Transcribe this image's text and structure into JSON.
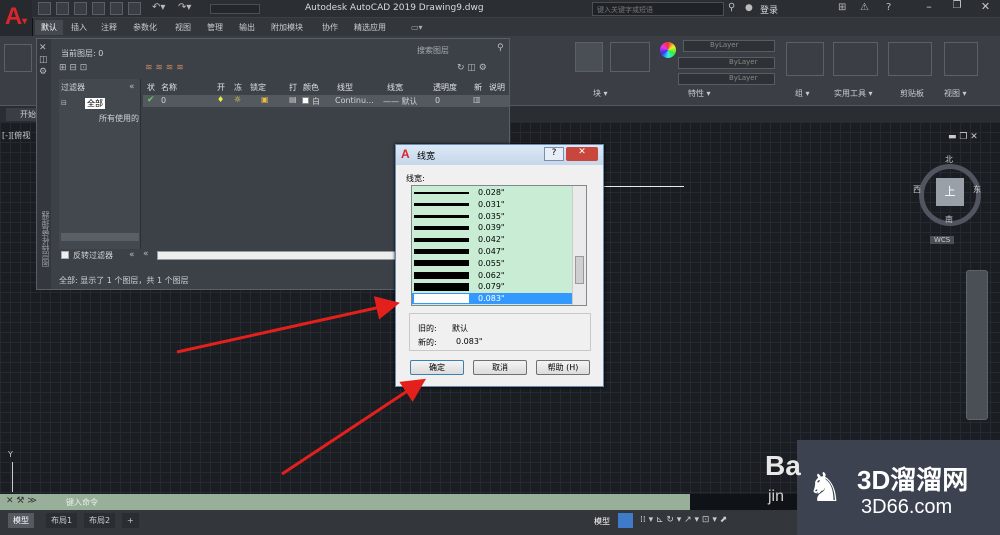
{
  "app": {
    "title": "Autodesk AutoCAD 2019    Drawing9.dwg",
    "search_placeholder": "键入关键字或短语",
    "login_label": "登录",
    "help": "?"
  },
  "ribbon_tabs": [
    "默认",
    "插入",
    "注释",
    "参数化",
    "视图",
    "管理",
    "输出",
    "附加模块",
    "协作",
    "精选应用"
  ],
  "ribbon_groups": [
    "块",
    "特性",
    "组",
    "实用工具",
    "剪贴板",
    "视图"
  ],
  "ribbon_props": [
    "ByLayer",
    "ByLayer",
    "ByLayer"
  ],
  "doc_tab": "开始",
  "viewport_label": "[-][俯视",
  "layer_palette": {
    "current_layer": "当前图层: 0",
    "search_placeholder": "搜索图层",
    "filter_header": "过滤器",
    "tree_all": "全部",
    "tree_used": "所有使用的",
    "invert_filter": "反转过滤器",
    "columns": [
      "状",
      "名称",
      "开",
      "冻",
      "锁定",
      "打",
      "颜色",
      "线型",
      "线宽",
      "透明度",
      "新",
      "说明"
    ],
    "row": {
      "name": "0",
      "color": "白",
      "linetype": "Continu...",
      "lineweight": "—— 默认",
      "transparency": "0"
    },
    "status": "全部: 显示了 1 个图层，共 1 个图层",
    "side_label": "图层特性管理器"
  },
  "dialog": {
    "title": "线宽",
    "list_label": "线宽:",
    "items": [
      "0.028\"",
      "0.031\"",
      "0.035\"",
      "0.039\"",
      "0.042\"",
      "0.047\"",
      "0.055\"",
      "0.062\"",
      "0.079\"",
      "0.083\""
    ],
    "selected_index": 9,
    "old_label": "旧的:",
    "old_value": "默认",
    "new_label": "新的:",
    "new_value": "0.083\"",
    "ok": "确定",
    "cancel": "取消",
    "help": "帮助 (H)"
  },
  "viewcube": {
    "north": "北",
    "south": "南",
    "east": "东",
    "west": "西",
    "top": "上",
    "wcs": "WCS"
  },
  "command_placeholder": "键入命令",
  "layout_tabs": [
    "模型",
    "布局1",
    "布局2",
    "+"
  ],
  "status_model": "模型",
  "watermark": {
    "brand_3d": "3D溜溜网",
    "domain": "3D66.com",
    "baidu": "Ba",
    "jing": "jin"
  },
  "colors": {
    "accent_red": "#d8262b",
    "selection": "#3399ff",
    "list_bg": "#c8ecd4"
  }
}
